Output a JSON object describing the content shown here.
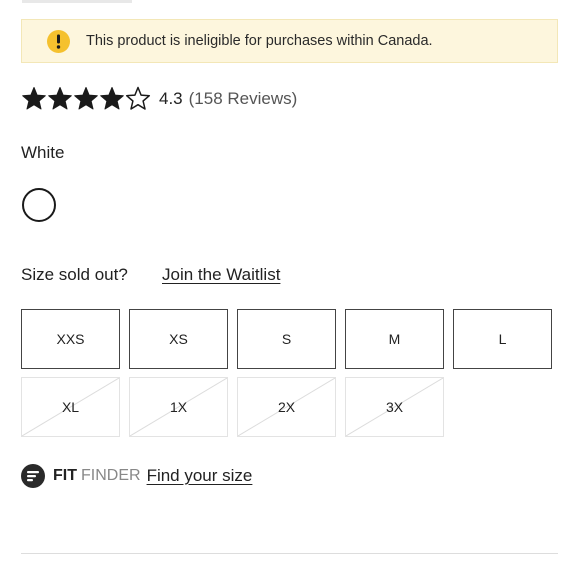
{
  "notice": {
    "icon": "exclamation-icon",
    "text": "This product is ineligible for purchases within Canada.",
    "background": "#fdf6dd",
    "icon_color": "#f5c12e"
  },
  "rating": {
    "stars_filled": 4,
    "stars_total": 5,
    "value": "4.3",
    "count_text": "(158 Reviews)"
  },
  "color": {
    "label": "White",
    "swatch": "#ffffff"
  },
  "size": {
    "sold_out_text": "Size sold out?",
    "waitlist_link": "Join the Waitlist",
    "options": [
      {
        "label": "XXS",
        "available": true
      },
      {
        "label": "XS",
        "available": true
      },
      {
        "label": "S",
        "available": true
      },
      {
        "label": "M",
        "available": true
      },
      {
        "label": "L",
        "available": true
      },
      {
        "label": "XL",
        "available": false
      },
      {
        "label": "1X",
        "available": false
      },
      {
        "label": "2X",
        "available": false
      },
      {
        "label": "3X",
        "available": false
      }
    ]
  },
  "fit_finder": {
    "brand_bold": "FIT",
    "brand_light": "FINDER",
    "link": "Find your size"
  }
}
